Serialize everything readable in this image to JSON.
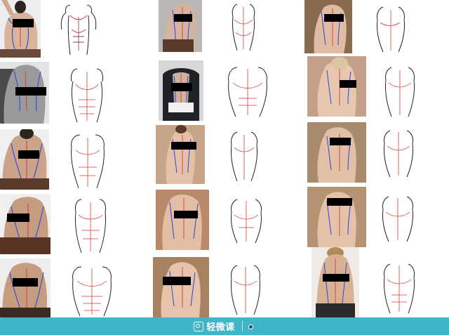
{
  "footer": {
    "logo_text": "轻微课",
    "tagline": "",
    "author": ""
  },
  "colors": {
    "footer_bg": "#3fb5c8",
    "censor_bar": "#000000",
    "anatomy_line_blue": "#3a4fd6",
    "anatomy_line_red": "#d83a3a"
  }
}
